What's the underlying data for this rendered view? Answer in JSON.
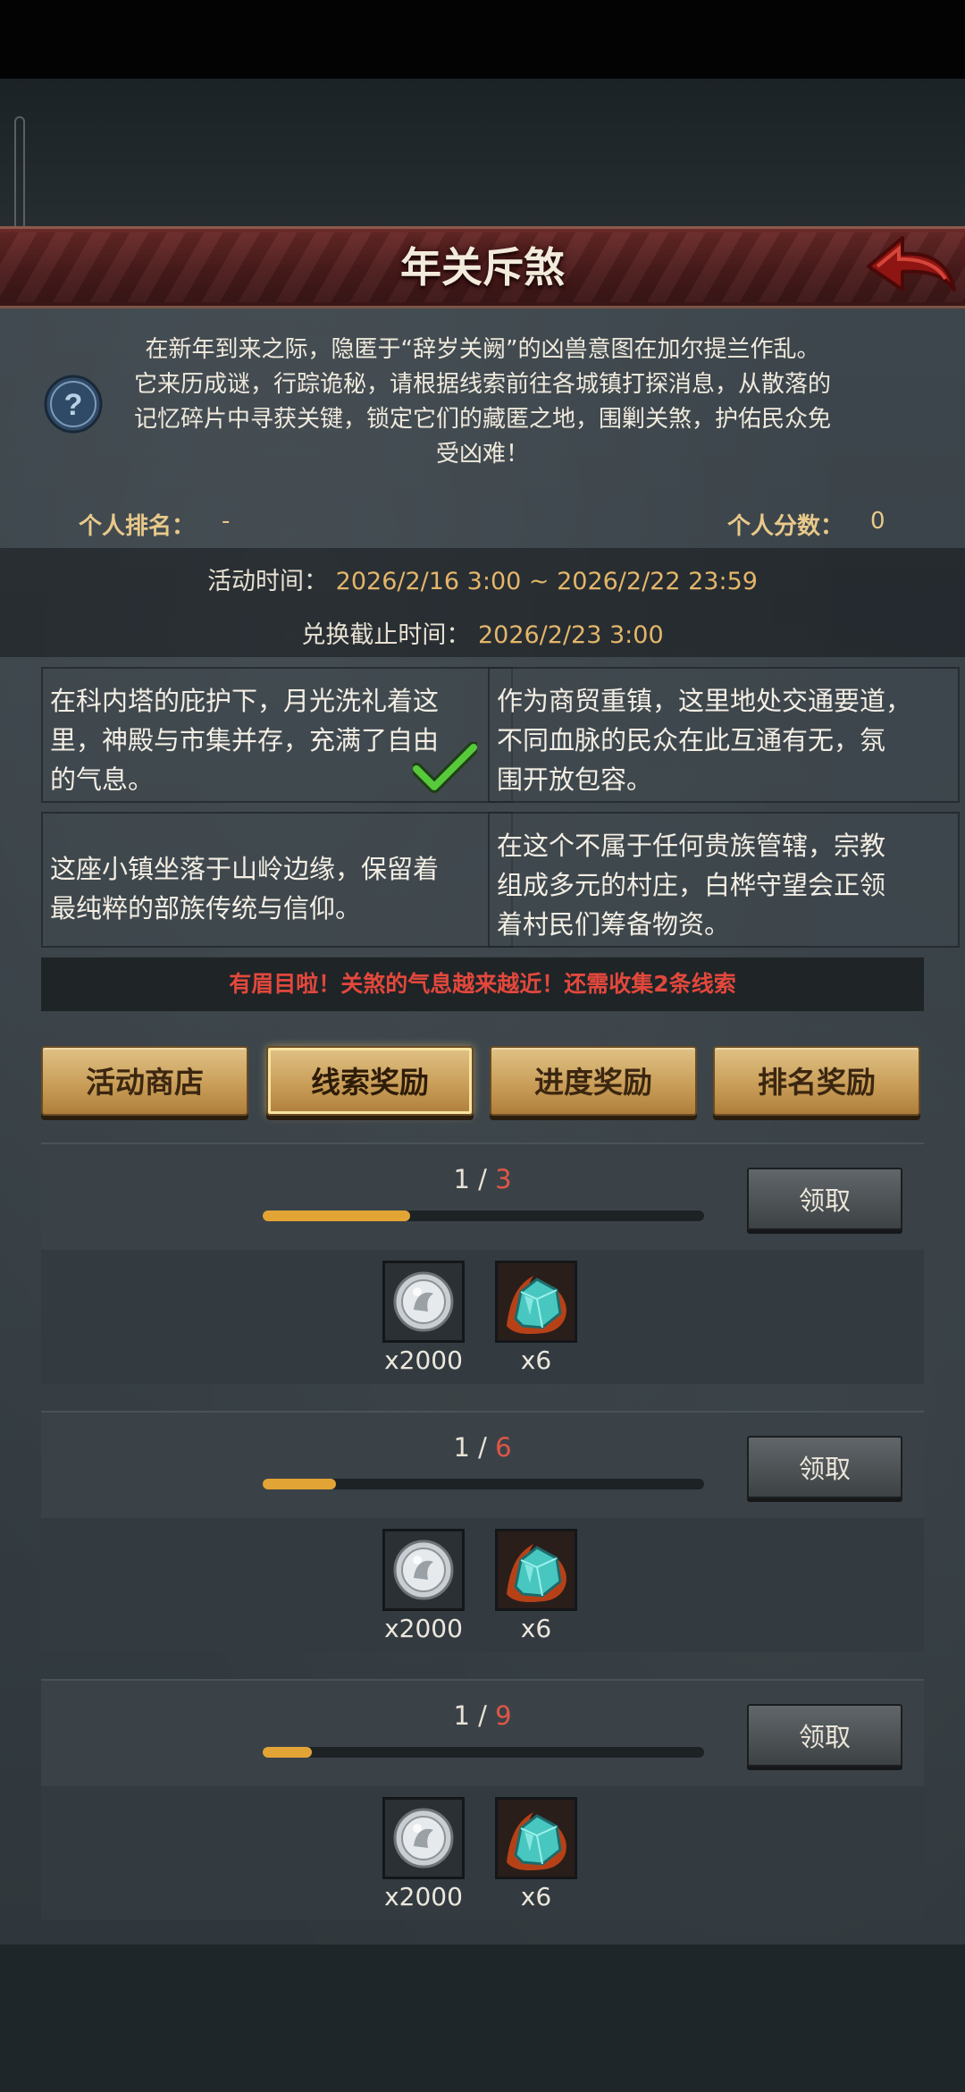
{
  "header": {
    "title": "年关斥煞"
  },
  "intro": {
    "lines": [
      "在新年到来之际，隐匿于“辞岁关阙”的凶兽意图在加尔提兰作乱。",
      "它来历成谜，行踪诡秘，请根据线索前往各城镇打探消息，从散落的",
      "记忆碎片中寻获关键，锁定它们的藏匿之地，围剿关煞，护佑民众免",
      "受凶难！"
    ]
  },
  "stats": {
    "rank_label": "个人排名：",
    "rank_value": "-",
    "score_label": "个人分数：",
    "score_value": "0"
  },
  "times": {
    "event_label": "活动时间：",
    "event_value": "2026/2/16 3:00 ~ 2026/2/22 23:59",
    "exchange_label": "兑换截止时间：",
    "exchange_value": "2026/2/23 3:00"
  },
  "clues": [
    {
      "lines": [
        "在科内塔的庇护下，月光洗礼着这",
        "里，神殿与市集并存，充满了自由",
        "的气息。"
      ],
      "collected": true
    },
    {
      "lines": [
        "作为商贸重镇，这里地处交通要道，",
        "不同血脉的民众在此互通有无，氛",
        "围开放包容。"
      ],
      "collected": false
    },
    {
      "lines": [
        "这座小镇坐落于山岭边缘，保留着",
        "最纯粹的部族传统与信仰。"
      ],
      "collected": false
    },
    {
      "lines": [
        "在这个不属于任何贵族管辖，宗教",
        "组成多元的村庄，白桦守望会正领",
        "着村民们筹备物资。"
      ],
      "collected": false
    }
  ],
  "hint": "有眉目啦！关煞的气息越来越近！还需收集2条线索",
  "tabs": [
    {
      "label": "活动商店",
      "active": false
    },
    {
      "label": "线索奖励",
      "active": true
    },
    {
      "label": "进度奖励",
      "active": false
    },
    {
      "label": "排名奖励",
      "active": false
    }
  ],
  "rewards": [
    {
      "current": "1",
      "sep": " / ",
      "total": "3",
      "progress": 0.333,
      "button": "领取",
      "items": [
        {
          "icon": "silver-coin-icon",
          "qty": "x2000"
        },
        {
          "icon": "crystal-ore-icon",
          "qty": "x6"
        }
      ]
    },
    {
      "current": "1",
      "sep": " / ",
      "total": "6",
      "progress": 0.167,
      "button": "领取",
      "items": [
        {
          "icon": "silver-coin-icon",
          "qty": "x2000"
        },
        {
          "icon": "crystal-ore-icon",
          "qty": "x6"
        }
      ]
    },
    {
      "current": "1",
      "sep": " / ",
      "total": "9",
      "progress": 0.111,
      "button": "领取",
      "items": [
        {
          "icon": "silver-coin-icon",
          "qty": "x2000"
        },
        {
          "icon": "crystal-ore-icon",
          "qty": "x6"
        }
      ]
    }
  ],
  "colors": {
    "accent_gold": "#e4b66a",
    "hint_red": "#e2483c",
    "progress_orange": "#e3a436",
    "title_red": "#5a2222"
  }
}
